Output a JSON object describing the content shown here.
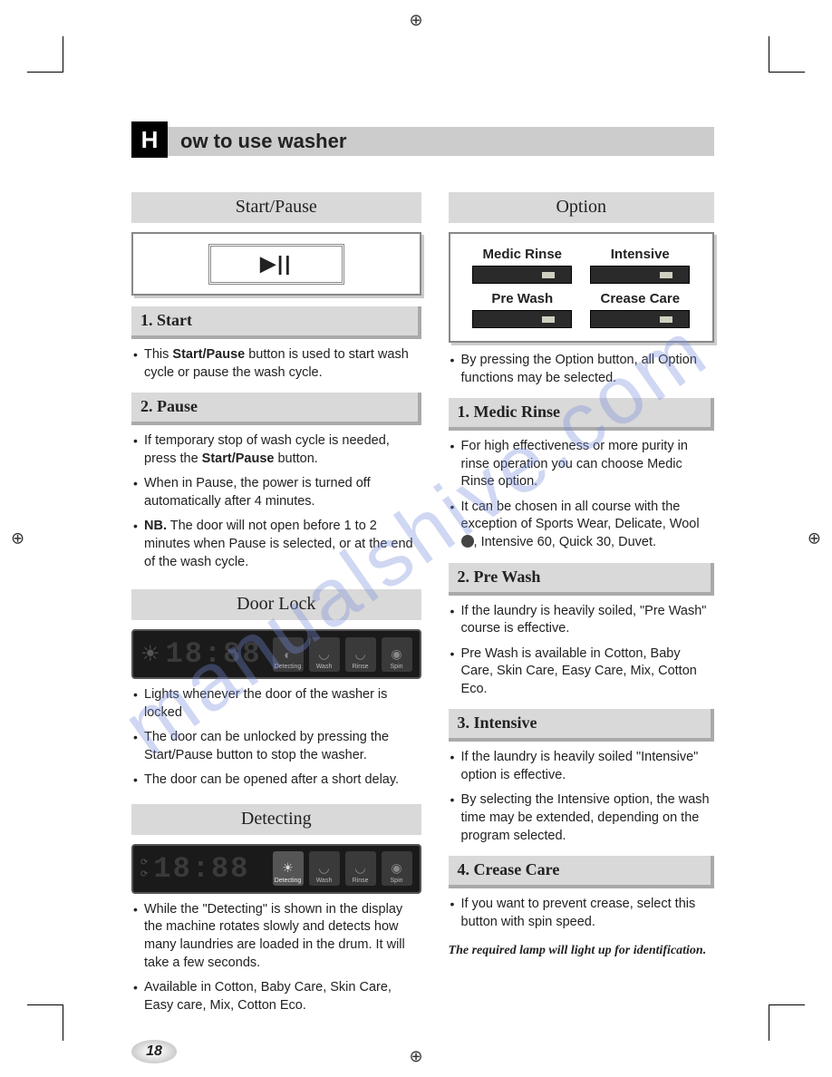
{
  "title_initial": "H",
  "title_rest": "ow to use washer",
  "page_number": "18",
  "left": {
    "start_pause_heading": "Start/Pause",
    "start_heading": "1. Start",
    "start_bullets": [
      "This Start/Pause button is used  to start wash cycle or pause the wash cycle."
    ],
    "pause_heading": "2. Pause",
    "pause_bullets": [
      "If temporary stop of wash cycle is needed, press the Start/Pause button.",
      "When in Pause, the power is turned off automatically after 4 minutes.",
      "NB. The door will not open before 1 to 2 minutes when Pause is selected, or at the end of the wash cycle."
    ],
    "door_lock_heading": "Door Lock",
    "door_lock_display": "18:88",
    "door_lock_stages": [
      "Detecting",
      "Wash",
      "Rinse",
      "Spin"
    ],
    "door_lock_bullets": [
      "Lights whenever the door of  the washer is locked",
      "The door can be unlocked by pressing the Start/Pause button to stop the washer.",
      "The door can be opened after a short delay."
    ],
    "detecting_heading": "Detecting",
    "detecting_display": "18:88",
    "detecting_stages": [
      "Detecting",
      "Wash",
      "Rinse",
      "Spin"
    ],
    "detecting_bullets": [
      "While the \"Detecting\" is shown in the display the machine rotates slowly and detects how many laundries are loaded in the drum. It will take a few seconds.",
      "Available in Cotton, Baby Care, Skin Care, Easy care, Mix, Cotton Eco."
    ]
  },
  "right": {
    "option_heading": "Option",
    "options": [
      "Medic Rinse",
      "Intensive",
      "Pre Wash",
      "Crease Care"
    ],
    "option_intro": [
      "By pressing the Option button, all Option functions may be selected."
    ],
    "medic_heading": "1. Medic Rinse",
    "medic_bullets": [
      "For high effectiveness or more purity in rinse operation you can choose Medic Rinse option.",
      "It can be chosen in all course with the exception of Sports Wear, Delicate, Wool ⬤, Intensive 60, Quick 30, Duvet."
    ],
    "prewash_heading": "2. Pre Wash",
    "prewash_bullets": [
      "If the laundry is heavily soiled, \"Pre Wash\" course is effective.",
      "Pre Wash is available in Cotton, Baby Care, Skin Care, Easy Care, Mix, Cotton Eco."
    ],
    "intensive_heading": "3. Intensive",
    "intensive_bullets": [
      "If the laundry is heavily soiled \"Intensive\" option is effective.",
      "By selecting the Intensive option, the wash time may be extended, depending on the program selected."
    ],
    "crease_heading": "4. Crease Care",
    "crease_bullets": [
      "If you want to prevent crease, select this button with spin speed."
    ],
    "footnote": "The required lamp will light up for identification."
  }
}
